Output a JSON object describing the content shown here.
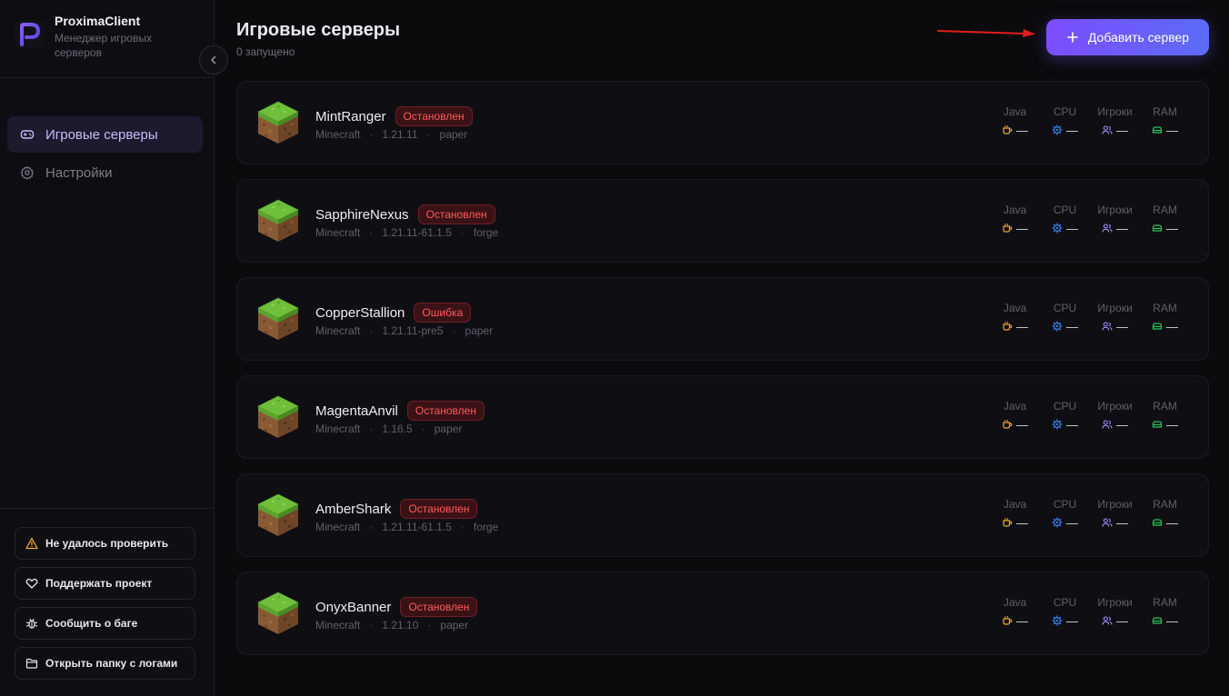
{
  "app": {
    "name": "ProximaClient",
    "subtitle": "Менеджер игровых серверов"
  },
  "nav": {
    "items": [
      {
        "label": "Игровые серверы",
        "icon": "gamepad-icon",
        "active": true
      },
      {
        "label": "Настройки",
        "icon": "gear-icon",
        "active": false
      }
    ]
  },
  "sidebar_bottom": {
    "buttons": [
      {
        "label": "Не удалось проверить",
        "icon": "warning-icon"
      },
      {
        "label": "Поддержать проект",
        "icon": "heart-icon"
      },
      {
        "label": "Сообщить о баге",
        "icon": "bug-icon"
      },
      {
        "label": "Открыть папку с логами",
        "icon": "folder-icon"
      }
    ]
  },
  "header": {
    "title": "Игровые серверы",
    "subtitle": "0 запущено",
    "add_label": "Добавить сервер"
  },
  "stat_labels": {
    "java": "Java",
    "cpu": "CPU",
    "players": "Игроки",
    "ram": "RAM"
  },
  "colors": {
    "java": "#f0a72e",
    "cpu": "#3b82f6",
    "players": "#a78bfa",
    "ram": "#22c55e",
    "accent": "#7c4dff",
    "status_red": "#ff5a5a"
  },
  "servers": [
    {
      "name": "MintRanger",
      "status": "Остановлен",
      "game": "Minecraft",
      "version": "1.21.11",
      "loader": "paper",
      "java": "—",
      "cpu": "—",
      "players": "—",
      "ram": "—"
    },
    {
      "name": "SapphireNexus",
      "status": "Остановлен",
      "game": "Minecraft",
      "version": "1.21.11-61.1.5",
      "loader": "forge",
      "java": "—",
      "cpu": "—",
      "players": "—",
      "ram": "—"
    },
    {
      "name": "CopperStallion",
      "status": "Ошибка",
      "game": "Minecraft",
      "version": "1.21.11-pre5",
      "loader": "paper",
      "java": "—",
      "cpu": "—",
      "players": "—",
      "ram": "—"
    },
    {
      "name": "MagentaAnvil",
      "status": "Остановлен",
      "game": "Minecraft",
      "version": "1.16.5",
      "loader": "paper",
      "java": "—",
      "cpu": "—",
      "players": "—",
      "ram": "—"
    },
    {
      "name": "AmberShark",
      "status": "Остановлен",
      "game": "Minecraft",
      "version": "1.21.11-61.1.5",
      "loader": "forge",
      "java": "—",
      "cpu": "—",
      "players": "—",
      "ram": "—"
    },
    {
      "name": "OnyxBanner",
      "status": "Остановлен",
      "game": "Minecraft",
      "version": "1.21.10",
      "loader": "paper",
      "java": "—",
      "cpu": "—",
      "players": "—",
      "ram": "—"
    }
  ]
}
